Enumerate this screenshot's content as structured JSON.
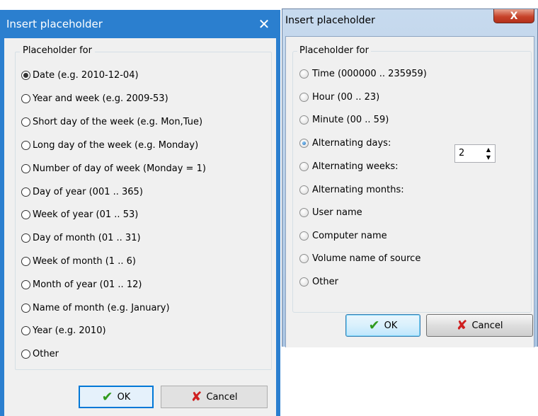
{
  "dialog_left": {
    "title": "Insert placeholder",
    "close_glyph": "✕",
    "group_label": "Placeholder for",
    "options": [
      {
        "label": "Date (e.g. 2010-12-04)",
        "checked": true
      },
      {
        "label": "Year and week (e.g. 2009-53)",
        "checked": false
      },
      {
        "label": "Short day of the week (e.g. Mon,Tue)",
        "checked": false
      },
      {
        "label": "Long day of the week (e.g. Monday)",
        "checked": false
      },
      {
        "label": "Number of day of week (Monday = 1)",
        "checked": false
      },
      {
        "label": "Day of year (001 .. 365)",
        "checked": false
      },
      {
        "label": "Week of year (01 .. 53)",
        "checked": false
      },
      {
        "label": "Day of month (01 .. 31)",
        "checked": false
      },
      {
        "label": "Week of month (1 .. 6)",
        "checked": false
      },
      {
        "label": "Month of year (01 .. 12)",
        "checked": false
      },
      {
        "label": "Name of month (e.g. January)",
        "checked": false
      },
      {
        "label": "Year (e.g. 2010)",
        "checked": false
      },
      {
        "label": "Other",
        "checked": false
      }
    ],
    "ok_label": "OK",
    "cancel_label": "Cancel"
  },
  "dialog_right": {
    "title": "Insert placeholder",
    "close_glyph": "X",
    "group_label": "Placeholder for",
    "options": [
      {
        "label": "Time (000000 .. 235959)",
        "checked": false
      },
      {
        "label": "Hour (00 .. 23)",
        "checked": false
      },
      {
        "label": "Minute (00 .. 59)",
        "checked": false
      },
      {
        "label": "Alternating days:",
        "checked": true
      },
      {
        "label": "Alternating weeks:",
        "checked": false
      },
      {
        "label": "Alternating months:",
        "checked": false
      },
      {
        "label": "User name",
        "checked": false
      },
      {
        "label": "Computer name",
        "checked": false
      },
      {
        "label": "Volume name of source",
        "checked": false
      },
      {
        "label": "Other",
        "checked": false
      }
    ],
    "spin_value": "2",
    "ok_label": "OK",
    "cancel_label": "Cancel"
  },
  "icons": {
    "ok": "check-icon",
    "cancel": "x-icon",
    "spin_up": "triangle-up-icon",
    "spin_down": "triangle-down-icon"
  },
  "colors": {
    "win10_titlebar": "#2b7fcf",
    "win10_default_button": "#0078d7",
    "win7_titlebar": "#c7daee",
    "win7_close": "#c7432a",
    "ok_check": "#2f9a1d",
    "cancel_x": "#cf1f1f"
  }
}
